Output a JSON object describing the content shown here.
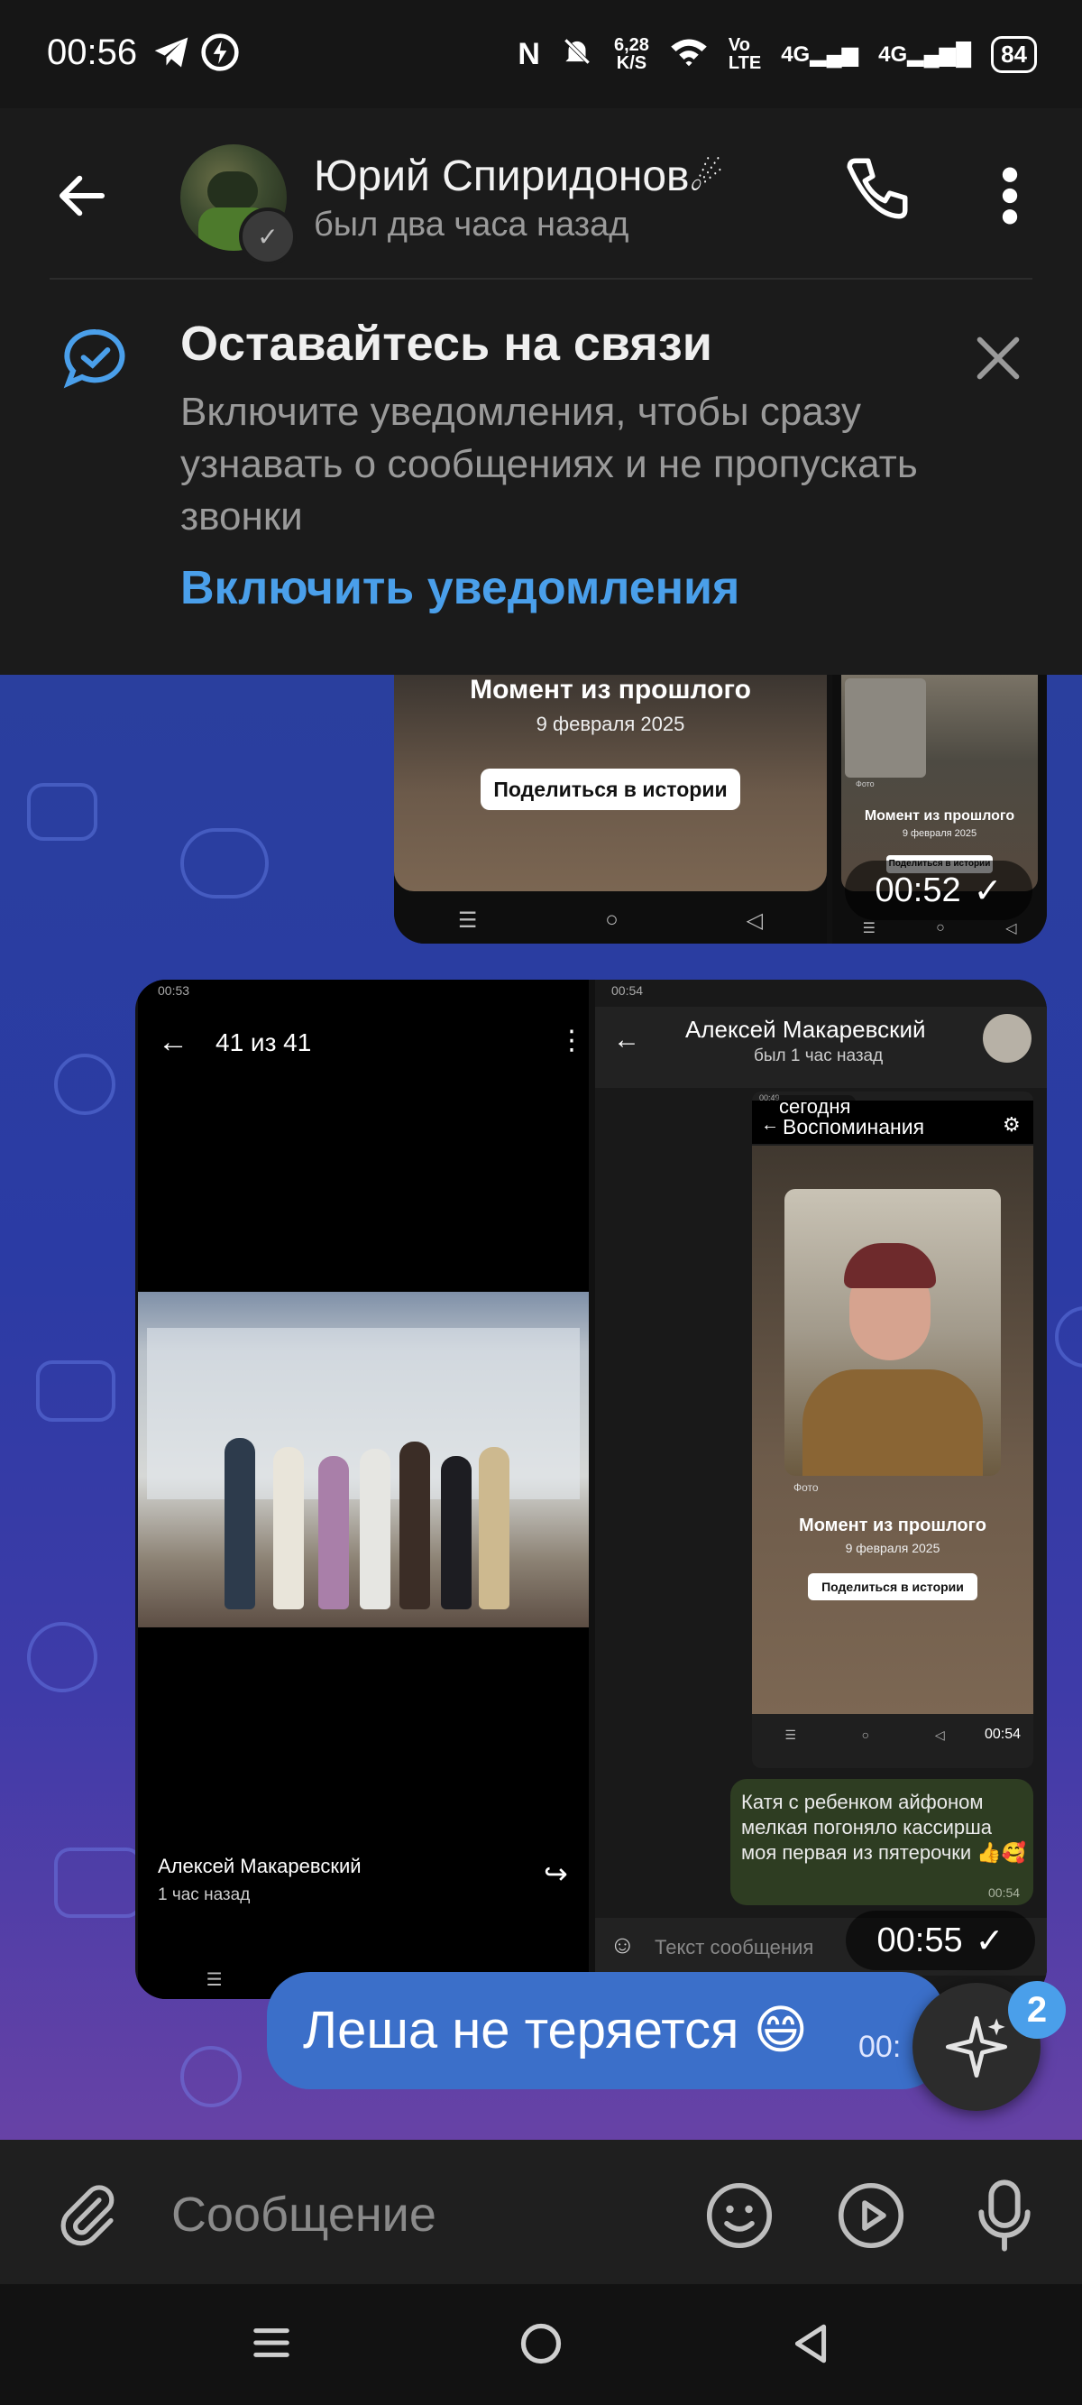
{
  "status_bar": {
    "time": "00:56",
    "net_speed": "6,28",
    "net_unit": "K/S",
    "volte": "Vo",
    "volte_sub": "LTE",
    "sig1": "4G",
    "sig2": "4G",
    "battery": "84"
  },
  "header": {
    "contact_name": "Юрий Спиридонов",
    "contact_status": "был два часа назад"
  },
  "banner": {
    "title": "Оставайтесь на связи",
    "text": "Включите уведомления, чтобы сразу узнавать о сообщениях и не пропускать звонки",
    "action": "Включить уведомления"
  },
  "messages": {
    "media1": {
      "left_title": "Момент из прошлого",
      "left_date": "9 февраля 2025",
      "left_button": "Поделиться в истории",
      "right_photo_label": "Фото",
      "right_title": "Момент из прошлого",
      "right_date": "9 февраля 2025",
      "right_button": "Поделиться в истории",
      "time": "00:52"
    },
    "media2": {
      "left": {
        "status_time": "00:53",
        "counter": "41 из 41",
        "author": "Алексей Макаревский",
        "ago": "1 час назад"
      },
      "right": {
        "status_time": "00:54",
        "chat_name": "Алексей Макаревский",
        "chat_status": "был 1 час назад",
        "inner_status_time": "00:49",
        "date_chip": "сегодня",
        "memories_title": "Воспоминания",
        "photo_label": "Фото",
        "memory_title": "Момент из прошлого",
        "memory_date": "9 февраля 2025",
        "memory_button": "Поделиться в истории",
        "memory_time": "00:54",
        "reply_text": "Катя с ребенком айфоном мелкая погоняло кассирша моя первая из пятерочки 👍🥰",
        "reply_time": "00:54",
        "input_placeholder": "Текст сообщения"
      },
      "time": "00:55"
    },
    "text_bubble": {
      "text": "Леша не теряется 😄",
      "time": "00:"
    },
    "fab_badge": "2"
  },
  "input": {
    "placeholder": "Сообщение"
  },
  "icons": {
    "back": "back-arrow-icon",
    "call": "phone-icon",
    "more": "more-vert-icon",
    "banner": "chat-bubble-check-icon",
    "close": "close-icon",
    "attach": "paperclip-icon",
    "emoji": "emoji-icon",
    "video": "play-circle-icon",
    "mic": "microphone-icon",
    "fab": "sparkle-icon"
  },
  "colors": {
    "accent": "#4a9fea",
    "bubble": "#3b6fc9"
  }
}
